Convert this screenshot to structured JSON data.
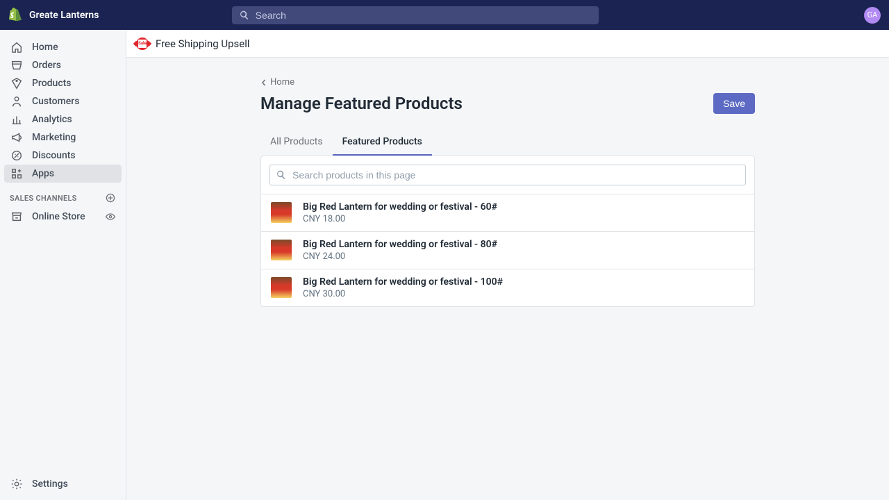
{
  "topbar": {
    "store_name": "Greate Lanterns",
    "search_placeholder": "Search",
    "avatar_initials": "GA"
  },
  "sidebar": {
    "items": [
      {
        "label": "Home",
        "icon": "home-icon"
      },
      {
        "label": "Orders",
        "icon": "orders-icon"
      },
      {
        "label": "Products",
        "icon": "products-icon"
      },
      {
        "label": "Customers",
        "icon": "customers-icon"
      },
      {
        "label": "Analytics",
        "icon": "analytics-icon"
      },
      {
        "label": "Marketing",
        "icon": "marketing-icon"
      },
      {
        "label": "Discounts",
        "icon": "discounts-icon"
      },
      {
        "label": "Apps",
        "icon": "apps-icon"
      }
    ],
    "section_label": "SALES CHANNELS",
    "channel": {
      "label": "Online Store"
    },
    "settings_label": "Settings"
  },
  "app": {
    "title": "Free Shipping Upsell"
  },
  "page": {
    "breadcrumb": "Home",
    "title": "Manage Featured Products",
    "save_label": "Save",
    "tabs": [
      {
        "label": "All Products"
      },
      {
        "label": "Featured Products"
      }
    ],
    "search_placeholder": "Search products in this page",
    "products": [
      {
        "title": "Big Red Lantern for wedding or festival - 60#",
        "price": "CNY 18.00"
      },
      {
        "title": "Big Red Lantern for wedding or festival - 80#",
        "price": "CNY 24.00"
      },
      {
        "title": "Big Red Lantern for wedding or festival - 100#",
        "price": "CNY 30.00"
      }
    ]
  }
}
